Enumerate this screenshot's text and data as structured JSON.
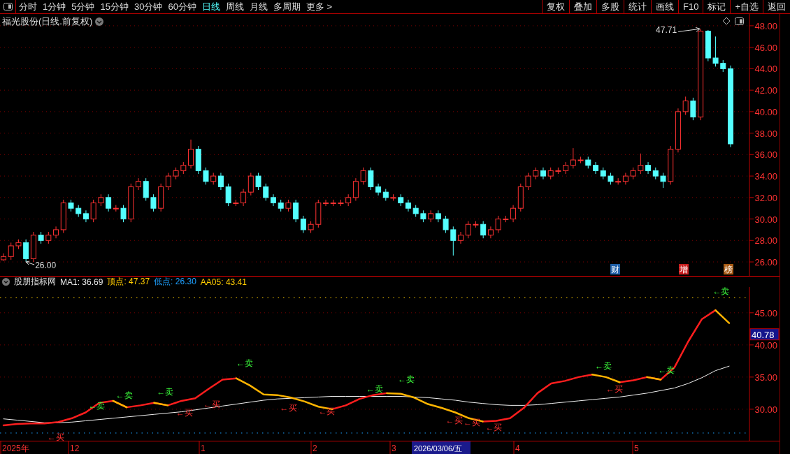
{
  "toolbar": {
    "periods": [
      {
        "label": "分时",
        "selected": false
      },
      {
        "label": "1分钟",
        "selected": false
      },
      {
        "label": "5分钟",
        "selected": false
      },
      {
        "label": "15分钟",
        "selected": false
      },
      {
        "label": "30分钟",
        "selected": false
      },
      {
        "label": "60分钟",
        "selected": false
      },
      {
        "label": "日线",
        "selected": true
      },
      {
        "label": "周线",
        "selected": false
      },
      {
        "label": "月线",
        "selected": false
      },
      {
        "label": "多周期",
        "selected": false
      },
      {
        "label": "更多 >",
        "selected": false
      }
    ],
    "buttons": [
      "复权",
      "叠加",
      "多股",
      "统计",
      "画线",
      "F10",
      "标记",
      "+自选",
      "返回"
    ]
  },
  "price_pane": {
    "title": "福光股份(日线.前复权)",
    "chart_data": {
      "type": "candlestick",
      "grid": true,
      "ylim": [
        24.7,
        49.1
      ],
      "yticks": [
        {
          "value": 48,
          "label": "48.00"
        },
        {
          "value": 46,
          "label": "46.00"
        },
        {
          "value": 44,
          "label": "44.00"
        },
        {
          "value": 42,
          "label": "42.00"
        },
        {
          "value": 40,
          "label": "40.00"
        },
        {
          "value": 38,
          "label": "38.00"
        },
        {
          "value": 36,
          "label": "36.00"
        },
        {
          "value": 34,
          "label": "34.00"
        },
        {
          "value": 32,
          "label": "32.00"
        },
        {
          "value": 30,
          "label": "30.00"
        },
        {
          "value": 28,
          "label": "28.00"
        },
        {
          "value": 26,
          "label": "26.00"
        }
      ],
      "ohlc": [
        [
          26.2,
          26.8,
          26.1,
          26.5
        ],
        [
          26.5,
          27.8,
          26.2,
          27.5
        ],
        [
          27.5,
          28.1,
          27.2,
          27.8
        ],
        [
          27.8,
          28.1,
          26.0,
          26.3
        ],
        [
          26.3,
          28.8,
          26.0,
          28.5
        ],
        [
          28.5,
          28.8,
          27.7,
          28
        ],
        [
          28,
          28.8,
          27.7,
          28.5
        ],
        [
          28.5,
          29.3,
          28.2,
          29
        ],
        [
          29,
          31.8,
          28.7,
          31.5
        ],
        [
          31.5,
          31.8,
          30.7,
          31
        ],
        [
          31,
          31.3,
          30.2,
          30.5
        ],
        [
          30.5,
          30.8,
          29.7,
          30
        ],
        [
          30,
          31.8,
          29.7,
          31.5
        ],
        [
          31.5,
          32.3,
          31.2,
          32
        ],
        [
          32,
          32.3,
          30.7,
          31
        ],
        [
          31,
          31.3,
          30.7,
          31
        ],
        [
          31,
          31.3,
          29.7,
          30
        ],
        [
          30,
          33.3,
          29.7,
          33
        ],
        [
          33,
          33.8,
          32.7,
          33.5
        ],
        [
          33.5,
          33.8,
          31.7,
          32
        ],
        [
          32,
          32.3,
          30.7,
          31
        ],
        [
          31,
          33.3,
          30.7,
          33
        ],
        [
          33,
          34.3,
          32.7,
          34
        ],
        [
          34,
          34.8,
          33.7,
          34.5
        ],
        [
          34.5,
          35.3,
          34.2,
          35
        ],
        [
          35,
          37.4,
          34.7,
          36.5
        ],
        [
          36.5,
          36.8,
          34.2,
          34.5
        ],
        [
          34.5,
          34.8,
          33.2,
          33.5
        ],
        [
          33.5,
          34.3,
          33.2,
          34
        ],
        [
          34,
          34.3,
          32.7,
          33
        ],
        [
          33,
          33.3,
          31.2,
          31.5
        ],
        [
          31.5,
          31.8,
          31.2,
          31.5
        ],
        [
          31.5,
          32.8,
          31.2,
          32.5
        ],
        [
          32.5,
          34.3,
          32.2,
          34
        ],
        [
          34,
          34.3,
          32.7,
          33
        ],
        [
          33,
          33.3,
          31.7,
          32
        ],
        [
          32,
          32.3,
          31.2,
          31.5
        ],
        [
          31.5,
          31.8,
          30.7,
          31
        ],
        [
          31,
          31.8,
          30.7,
          31.5
        ],
        [
          31.5,
          31.8,
          29.7,
          30
        ],
        [
          30,
          30.3,
          28.7,
          29
        ],
        [
          29,
          29.8,
          28.7,
          29.5
        ],
        [
          29.5,
          31.8,
          29.2,
          31.5
        ],
        [
          31.5,
          31.8,
          31.2,
          31.5
        ],
        [
          31.5,
          31.8,
          31.2,
          31.5
        ],
        [
          31.5,
          31.8,
          31.2,
          31.5
        ],
        [
          31.5,
          32.3,
          31.2,
          32
        ],
        [
          32,
          33.8,
          31.7,
          33.5
        ],
        [
          33.5,
          34.8,
          33.2,
          34.5
        ],
        [
          34.5,
          34.8,
          32.7,
          33
        ],
        [
          33,
          33.3,
          32.2,
          32.5
        ],
        [
          32.5,
          32.8,
          31.7,
          32
        ],
        [
          32,
          32.3,
          31.7,
          32
        ],
        [
          32,
          32.3,
          31.2,
          31.5
        ],
        [
          31.5,
          31.8,
          30.7,
          31
        ],
        [
          31,
          31.3,
          30.2,
          30.5
        ],
        [
          30.5,
          30.8,
          29.7,
          30
        ],
        [
          30,
          30.8,
          29.7,
          30.5
        ],
        [
          30.5,
          30.8,
          29.7,
          30
        ],
        [
          30,
          30.3,
          28.7,
          29
        ],
        [
          29,
          29.3,
          26.6,
          28
        ],
        [
          28,
          28.8,
          27.7,
          28.5
        ],
        [
          28.5,
          29.8,
          28.2,
          29.5
        ],
        [
          29.5,
          29.8,
          29.2,
          29.5
        ],
        [
          29.5,
          29.8,
          28.2,
          28.5
        ],
        [
          28.5,
          29.3,
          28.2,
          29
        ],
        [
          29,
          30.3,
          28.7,
          30
        ],
        [
          30,
          30.3,
          29.7,
          30
        ],
        [
          30,
          31.3,
          29.7,
          31
        ],
        [
          31,
          33.3,
          30.7,
          33
        ],
        [
          33,
          34.3,
          32.7,
          34
        ],
        [
          34,
          34.8,
          33.7,
          34.5
        ],
        [
          34.5,
          34.8,
          33.7,
          34
        ],
        [
          34,
          34.8,
          33.7,
          34.5
        ],
        [
          34.5,
          34.8,
          34.2,
          34.5
        ],
        [
          34.5,
          35.3,
          34.2,
          35
        ],
        [
          35,
          36.6,
          34.7,
          35.5
        ],
        [
          35.5,
          35.8,
          35.2,
          35.5
        ],
        [
          35.5,
          35.8,
          34.7,
          35
        ],
        [
          35,
          35.3,
          34.2,
          34.5
        ],
        [
          34.5,
          34.8,
          33.7,
          34
        ],
        [
          34,
          34.3,
          33.2,
          33.5
        ],
        [
          33.5,
          33.8,
          33.2,
          33.5
        ],
        [
          33.5,
          34.3,
          33.2,
          34
        ],
        [
          34,
          34.8,
          33.7,
          34.5
        ],
        [
          34.5,
          36.1,
          34.2,
          35
        ],
        [
          35,
          35.3,
          34.2,
          34.5
        ],
        [
          34.5,
          34.8,
          33.7,
          34
        ],
        [
          34,
          34.3,
          32.9,
          33.5
        ],
        [
          33.5,
          36.8,
          33.2,
          36.5
        ],
        [
          36.5,
          40.3,
          36.2,
          40
        ],
        [
          40,
          41.4,
          39.7,
          41
        ],
        [
          41,
          41.3,
          39.2,
          39.5
        ],
        [
          39.5,
          47.71,
          39.2,
          47.5
        ],
        [
          47.5,
          47.6,
          44.7,
          45
        ],
        [
          45,
          47,
          44.2,
          44.5
        ],
        [
          44.5,
          44.8,
          43.7,
          44
        ],
        [
          44,
          44.3,
          36.7,
          37
        ]
      ],
      "annotations": [
        "47.71",
        "26.00"
      ]
    },
    "event_badges": [
      {
        "text": "财",
        "color": "#1f5fa8"
      },
      {
        "text": "增",
        "color": "#c81e1e"
      },
      {
        "text": "榜",
        "color": "#a85a14"
      }
    ]
  },
  "indicator_pane": {
    "name": "股朋指标网",
    "legend": [
      {
        "label": "MA1:",
        "value": "36.69",
        "color": "#e8e8e8"
      },
      {
        "label": "顶点:",
        "value": "47.37",
        "color": "#ffcc00"
      },
      {
        "label": "低点:",
        "value": "26.30",
        "color": "#1ea0ff"
      },
      {
        "label": "AA05:",
        "value": "43.41",
        "color": "#ffcc00"
      }
    ],
    "time_axis": [
      "2025年",
      "12",
      "1",
      "2",
      "3",
      "4",
      "5"
    ],
    "signals": [
      {
        "kind": "sell",
        "text": "←卖"
      },
      {
        "kind": "sell",
        "text": "←卖"
      },
      {
        "kind": "sell",
        "text": "←卖"
      },
      {
        "kind": "sell",
        "text": "←卖"
      },
      {
        "kind": "sell",
        "text": "←卖"
      },
      {
        "kind": "sell",
        "text": "←卖"
      },
      {
        "kind": "sell",
        "text": "←卖"
      },
      {
        "kind": "sell",
        "text": "←卖"
      },
      {
        "kind": "sell",
        "text": "←卖"
      },
      {
        "kind": "buy",
        "text": "←买"
      },
      {
        "kind": "buy",
        "text": "←买"
      },
      {
        "kind": "buy",
        "text": "←买"
      },
      {
        "kind": "buy",
        "text": "←买"
      },
      {
        "kind": "buy",
        "text": "←买"
      },
      {
        "kind": "buy",
        "text": "←买"
      },
      {
        "kind": "buy",
        "text": "←买"
      },
      {
        "kind": "buy",
        "text": "←买"
      },
      {
        "kind": "buy",
        "text": "←买"
      }
    ],
    "chart_data": {
      "type": "line",
      "grid": true,
      "ylim": [
        25.1,
        49.0
      ],
      "ref_lines": [
        {
          "axis": "y",
          "value": 47.37,
          "color": "#ffcc00"
        },
        {
          "axis": "y",
          "value": 26.3,
          "color": "#1ea0ff"
        }
      ],
      "yticks": [
        {
          "value": 45,
          "label": "45.00"
        },
        {
          "value": 40,
          "label": "40.00"
        },
        {
          "value": 35,
          "label": "35.00"
        },
        {
          "value": 30,
          "label": "30.00"
        }
      ],
      "series": [
        {
          "color": "#f0f0f0",
          "values": [
            28.5,
            28.3,
            28.1,
            27.9,
            27.9,
            28,
            28.2,
            28.4,
            28.6,
            28.8,
            29,
            29.2,
            29.4,
            29.6,
            29.9,
            30.2,
            30.5,
            30.8,
            31.1,
            31.4,
            31.6,
            31.7,
            31.8,
            31.9,
            32,
            32,
            32,
            32,
            32,
            32,
            31.9,
            31.8,
            31.6,
            31.4,
            31.1,
            30.9,
            30.7,
            30.6,
            30.6,
            30.7,
            30.9,
            31.1,
            31.3,
            31.5,
            31.7,
            31.9,
            32.2,
            32.5,
            32.9,
            33.3,
            34,
            34.9,
            36,
            36.7
          ]
        },
        {
          "color": "#ff1e1e",
          "values": [
            27.5,
            27.7,
            27.8,
            27.8,
            28,
            28.6,
            29.5,
            31,
            31.3,
            30.3,
            30.6,
            31,
            30.6,
            31.3,
            31.7,
            33.2,
            34.6,
            34.8,
            null,
            null,
            null,
            null,
            null,
            null,
            30,
            30.6,
            31.6,
            32.2,
            32.5,
            null,
            null,
            null,
            null,
            null,
            null,
            28.1,
            28.2,
            28.6,
            30.2,
            32.5,
            34,
            34.4,
            35,
            35.4,
            null,
            34.2,
            34.5,
            35,
            34.6,
            36.5,
            40.5,
            44,
            45.4,
            null
          ]
        },
        {
          "color": "#ffb400",
          "values": [
            null,
            null,
            null,
            null,
            null,
            null,
            null,
            null,
            31.3,
            30.3,
            null,
            31,
            30.6,
            null,
            null,
            null,
            null,
            34.8,
            33.7,
            32.3,
            32.2,
            31.8,
            31.2,
            30.4,
            30,
            null,
            null,
            null,
            32.5,
            32.4,
            31.8,
            30.8,
            30.2,
            29.5,
            28.6,
            28.1,
            null,
            null,
            null,
            null,
            null,
            null,
            null,
            35.4,
            35,
            34.2,
            null,
            35,
            34.6,
            null,
            null,
            null,
            45.4,
            43.4
          ]
        }
      ]
    },
    "cursor": {
      "date": "2026/03/06/五",
      "value": "40.78"
    }
  }
}
